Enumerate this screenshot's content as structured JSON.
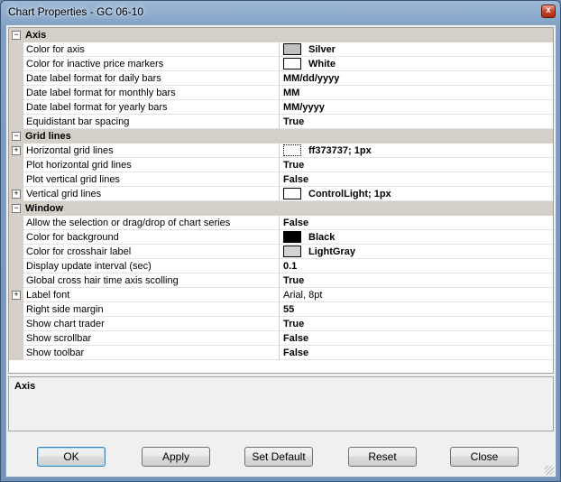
{
  "window": {
    "title": "Chart Properties - GC 06-10",
    "close_glyph": "x"
  },
  "grid": {
    "rows": [
      {
        "kind": "category",
        "label": "Axis",
        "toggle": "−"
      },
      {
        "kind": "property",
        "name": "Color for axis",
        "value": "Silver",
        "swatch": "#c0c0c0"
      },
      {
        "kind": "property",
        "name": "Color for inactive price markers",
        "value": "White",
        "swatch": "#ffffff"
      },
      {
        "kind": "property",
        "name": "Date label format for daily bars",
        "value": "MM/dd/yyyy"
      },
      {
        "kind": "property",
        "name": "Date label format for monthly bars",
        "value": "MM"
      },
      {
        "kind": "property",
        "name": "Date label format for yearly bars",
        "value": "MM/yyyy"
      },
      {
        "kind": "property",
        "name": "Equidistant bar spacing",
        "value": "True"
      },
      {
        "kind": "category",
        "label": "Grid lines",
        "toggle": "−"
      },
      {
        "kind": "property",
        "name": "Horizontal grid lines",
        "value": "ff373737; 1px",
        "swatch": "dotted",
        "expander": "+"
      },
      {
        "kind": "property",
        "name": "Plot horizontal grid lines",
        "value": "True"
      },
      {
        "kind": "property",
        "name": "Plot vertical grid lines",
        "value": "False"
      },
      {
        "kind": "property",
        "name": "Vertical grid lines",
        "value": "ControlLight; 1px",
        "swatch": "#ffffff",
        "expander": "+"
      },
      {
        "kind": "category",
        "label": "Window",
        "toggle": "−"
      },
      {
        "kind": "property",
        "name": "Allow the selection or drag/drop of chart series",
        "value": "False"
      },
      {
        "kind": "property",
        "name": "Color for background",
        "value": "Black",
        "swatch": "#000000"
      },
      {
        "kind": "property",
        "name": "Color for crosshair label",
        "value": "LightGray",
        "swatch": "#d3d3d3"
      },
      {
        "kind": "property",
        "name": "Display update interval (sec)",
        "value": "0.1"
      },
      {
        "kind": "property",
        "name": "Global cross hair time axis scolling",
        "value": "True"
      },
      {
        "kind": "property",
        "name": "Label font",
        "value": "Arial, 8pt",
        "expander": "+",
        "plain": true
      },
      {
        "kind": "property",
        "name": "Right side margin",
        "value": "55"
      },
      {
        "kind": "property",
        "name": "Show chart trader",
        "value": "True"
      },
      {
        "kind": "property",
        "name": "Show scrollbar",
        "value": "False"
      },
      {
        "kind": "property",
        "name": "Show toolbar",
        "value": "False"
      }
    ]
  },
  "description": {
    "title": "Axis"
  },
  "buttons": {
    "ok": "OK",
    "apply": "Apply",
    "set_default": "Set Default",
    "reset": "Reset",
    "close": "Close"
  }
}
